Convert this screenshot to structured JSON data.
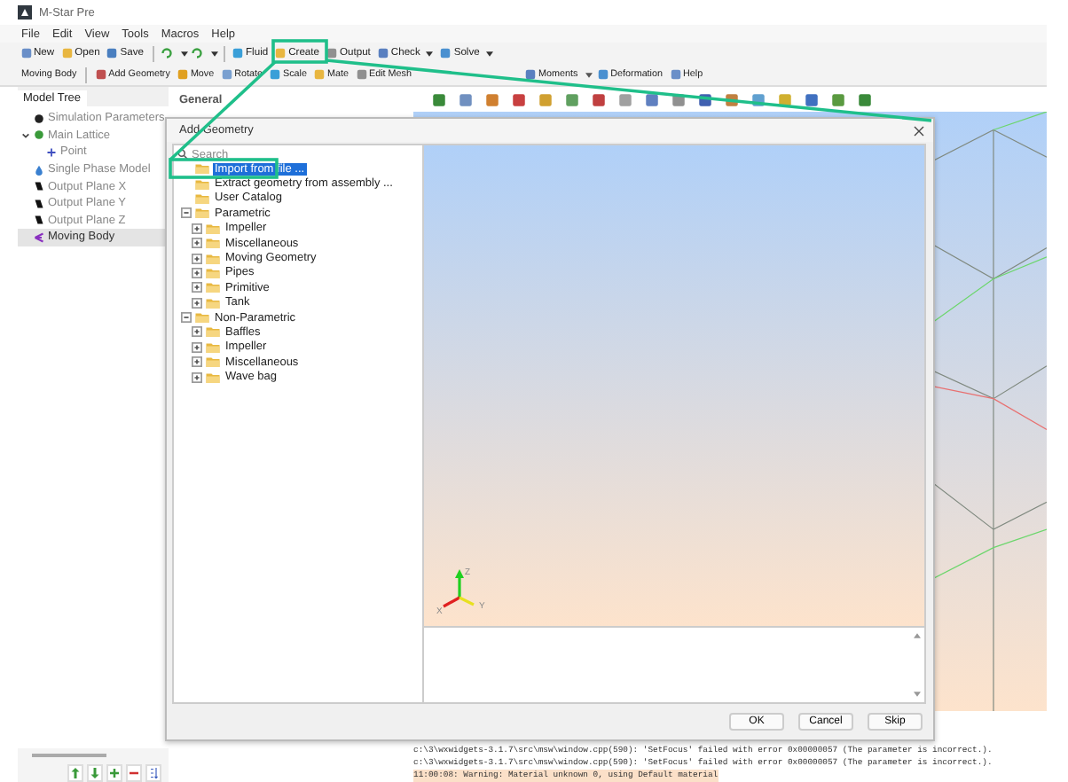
{
  "window": {
    "title": "M-Star Pre"
  },
  "menu": [
    "File",
    "Edit",
    "View",
    "Tools",
    "Macros",
    "Help"
  ],
  "toolbar": [
    {
      "kind": "button",
      "label": "New",
      "dropdown": false
    },
    {
      "kind": "button",
      "label": "Open",
      "dropdown": false
    },
    {
      "kind": "button",
      "label": "Save",
      "dropdown": false
    },
    {
      "kind": "separator"
    },
    {
      "kind": "icon",
      "dropdown": true
    },
    {
      "kind": "icon",
      "dropdown": true
    },
    {
      "kind": "separator"
    },
    {
      "kind": "button",
      "label": "Fluid",
      "dropdown": false
    },
    {
      "kind": "button",
      "label": "Create",
      "dropdown": false
    },
    {
      "kind": "button",
      "label": "Output",
      "dropdown": false
    },
    {
      "kind": "button",
      "label": "Check",
      "dropdown": true
    },
    {
      "kind": "button",
      "label": "Solve",
      "dropdown": true
    }
  ],
  "context_toolbar": {
    "context": "Moving Body",
    "items": [
      {
        "label": "Add Geometry",
        "caret_before": false
      },
      {
        "label": "Move",
        "caret_before": false
      },
      {
        "label": "Rotate",
        "caret_before": false
      },
      {
        "label": "Scale",
        "caret_before": false
      },
      {
        "label": "Mate",
        "caret_before": false
      },
      {
        "label": "Edit Mesh",
        "caret_before": false
      },
      {
        "label": "Moments",
        "caret_before": false
      },
      {
        "label": "Deformation",
        "caret_before": true
      },
      {
        "label": "Help",
        "caret_before": false
      }
    ]
  },
  "model_tree": {
    "title": "Model Tree",
    "items": [
      {
        "label": "Simulation Parameters",
        "selected": false
      },
      {
        "label": "Main Lattice",
        "selected": false,
        "expanded": true,
        "children": [
          {
            "label": "Point",
            "selected": false
          }
        ]
      },
      {
        "label": "Single Phase Model",
        "selected": false
      },
      {
        "label": "Output Plane X",
        "selected": false
      },
      {
        "label": "Output Plane Y",
        "selected": false
      },
      {
        "label": "Output Plane Z",
        "selected": false
      },
      {
        "label": "Moving Body",
        "selected": true
      }
    ]
  },
  "properties": {
    "title": "General"
  },
  "dialog": {
    "title": "Add Geometry",
    "search": {
      "placeholder": "Search"
    },
    "tree": [
      {
        "label": "Import from file ...",
        "selected": true
      },
      {
        "label": "Extract geometry from assembly ...",
        "selected": false
      },
      {
        "label": "User Catalog",
        "selected": false
      },
      {
        "label": "Parametric",
        "selected": false,
        "expanded": true,
        "children": [
          {
            "label": "Impeller",
            "selected": false,
            "expanded": false
          },
          {
            "label": "Miscellaneous",
            "selected": false,
            "expanded": false
          },
          {
            "label": "Moving Geometry",
            "selected": false,
            "expanded": false
          },
          {
            "label": "Pipes",
            "selected": false,
            "expanded": false
          },
          {
            "label": "Primitive",
            "selected": false,
            "expanded": false
          },
          {
            "label": "Tank",
            "selected": false,
            "expanded": false
          }
        ]
      },
      {
        "label": "Non-Parametric",
        "selected": false,
        "expanded": true,
        "children": [
          {
            "label": "Baffles",
            "selected": false,
            "expanded": false
          },
          {
            "label": "Impeller",
            "selected": false,
            "expanded": false
          },
          {
            "label": "Miscellaneous",
            "selected": false,
            "expanded": false
          },
          {
            "label": "Wave bag",
            "selected": false,
            "expanded": false
          }
        ]
      }
    ],
    "axis_labels": [
      "Z",
      "X",
      "Y"
    ],
    "buttons": [
      "OK",
      "Cancel",
      "Skip"
    ]
  },
  "console": [
    {
      "kind": "log",
      "text": "c:\\3\\wxwidgets-3.1.7\\src\\msw\\window.cpp(590): 'SetFocus' failed with error 0x00000057 (The parameter is incorrect.)."
    },
    {
      "kind": "log",
      "text": "c:\\3\\wxwidgets-3.1.7\\src\\msw\\window.cpp(590): 'SetFocus' failed with error 0x00000057 (The parameter is incorrect.)."
    },
    {
      "kind": "warning",
      "text": "11:00:08: Warning: Material unknown 0, using Default material"
    }
  ]
}
